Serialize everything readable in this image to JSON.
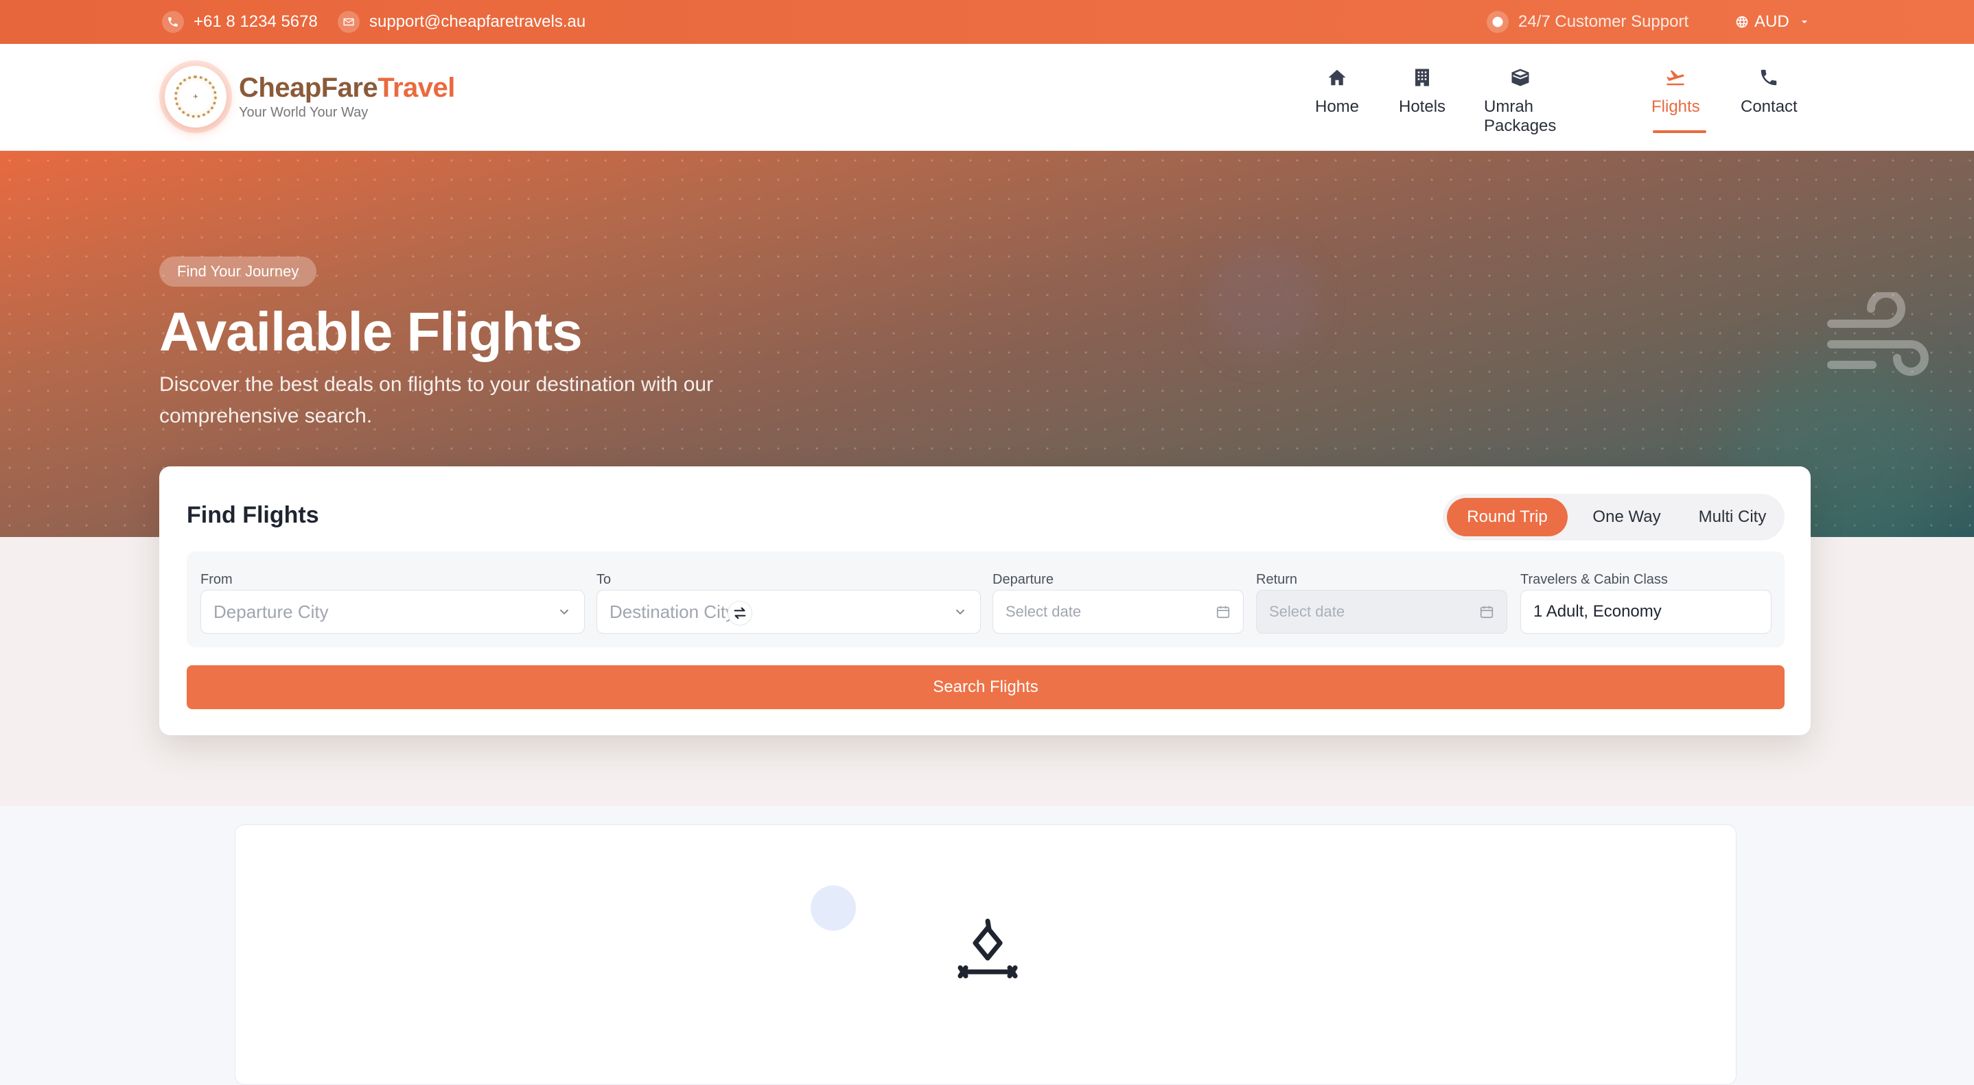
{
  "topbar": {
    "phone": "+61 8 1234 5678",
    "email": "support@cheapfaretravels.au",
    "support": "24/7 Customer Support",
    "currency": "AUD"
  },
  "brand": {
    "name_part1": "CheapFare",
    "name_part2": "Travel",
    "tagline": "Your World Your Way"
  },
  "nav": {
    "items": [
      {
        "label": "Home",
        "icon": "home-icon"
      },
      {
        "label": "Hotels",
        "icon": "hotel-icon"
      },
      {
        "label": "Umrah Packages",
        "icon": "kaaba-icon"
      },
      {
        "label": "Flights",
        "icon": "plane-departure-icon",
        "active": true
      },
      {
        "label": "Contact",
        "icon": "phone-icon"
      }
    ]
  },
  "hero": {
    "badge": "Find Your Journey",
    "title": "Available Flights",
    "subtitle": "Discover the best deals on flights to your destination with our comprehensive search."
  },
  "search": {
    "title": "Find Flights",
    "trip_types": [
      "Round Trip",
      "One Way",
      "Multi City"
    ],
    "active_trip": "Round Trip",
    "from": {
      "label": "From",
      "placeholder": "Departure City"
    },
    "to": {
      "label": "To",
      "placeholder": "Destination City"
    },
    "departure": {
      "label": "Departure",
      "placeholder": "Select date"
    },
    "return": {
      "label": "Return",
      "placeholder": "Select date"
    },
    "travelers": {
      "label": "Travelers & Cabin Class",
      "value": "1 Adult, Economy"
    },
    "submit": "Search Flights"
  },
  "colors": {
    "accent": "#ec6e45",
    "topbar": "#e8663b",
    "brand_dark": "#8a5a3a",
    "loader": "#e4ebfb"
  }
}
